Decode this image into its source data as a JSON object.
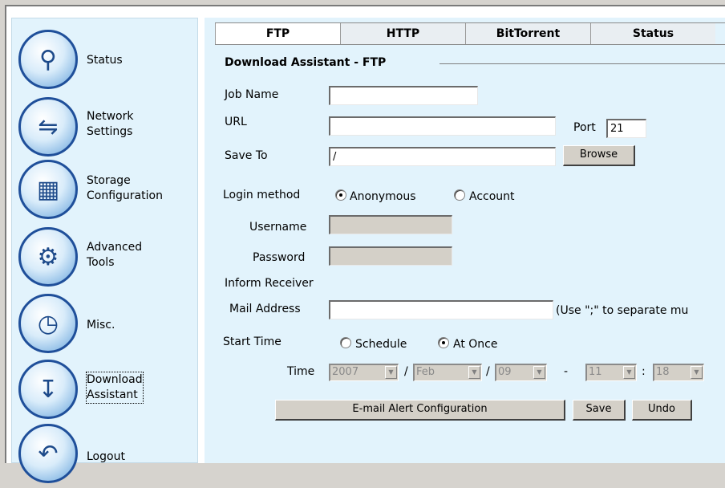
{
  "sidebar": {
    "items": [
      {
        "label": "Status",
        "icon": "magnifier-icon"
      },
      {
        "label": "Network\nSettings",
        "icon": "network-icon"
      },
      {
        "label": "Storage\nConfiguration",
        "icon": "storage-grid-icon"
      },
      {
        "label": "Advanced\nTools",
        "icon": "gears-icon"
      },
      {
        "label": "Misc.",
        "icon": "clock-icon"
      },
      {
        "label": "Download\nAssistant",
        "icon": "download-tray-icon"
      },
      {
        "label": "Logout",
        "icon": "back-arrow-icon"
      }
    ],
    "selected": "Download\nAssistant"
  },
  "tabs": [
    {
      "label": "FTP",
      "active": true
    },
    {
      "label": "HTTP",
      "active": false
    },
    {
      "label": "BitTorrent",
      "active": false
    },
    {
      "label": "Status",
      "active": false
    }
  ],
  "section_title": "Download Assistant - FTP",
  "form": {
    "job_name_label": "Job Name",
    "job_name_value": "",
    "url_label": "URL",
    "url_value": "",
    "port_label": "Port",
    "port_value": "21",
    "save_to_label": "Save To",
    "save_to_value": "/",
    "browse_label": "Browse",
    "login_method_label": "Login method",
    "login_options": [
      "Anonymous",
      "Account"
    ],
    "login_selected": "Anonymous",
    "username_label": "Username",
    "password_label": "Password",
    "inform_receiver_label": "Inform Receiver",
    "mail_address_label": "Mail Address",
    "mail_hint": "(Use \";\" to separate mu",
    "start_time_label": "Start Time",
    "start_options": [
      "Schedule",
      "At Once"
    ],
    "start_selected": "At Once",
    "time_label": "Time",
    "time_year": "2007",
    "time_month": "Feb",
    "time_day": "09",
    "time_hour": "11",
    "time_minute": "18",
    "sep_slash": "/",
    "sep_dash": "-",
    "sep_colon": ":"
  },
  "buttons": {
    "email_alert": "E-mail Alert Configuration",
    "save": "Save",
    "undo": "Undo"
  }
}
